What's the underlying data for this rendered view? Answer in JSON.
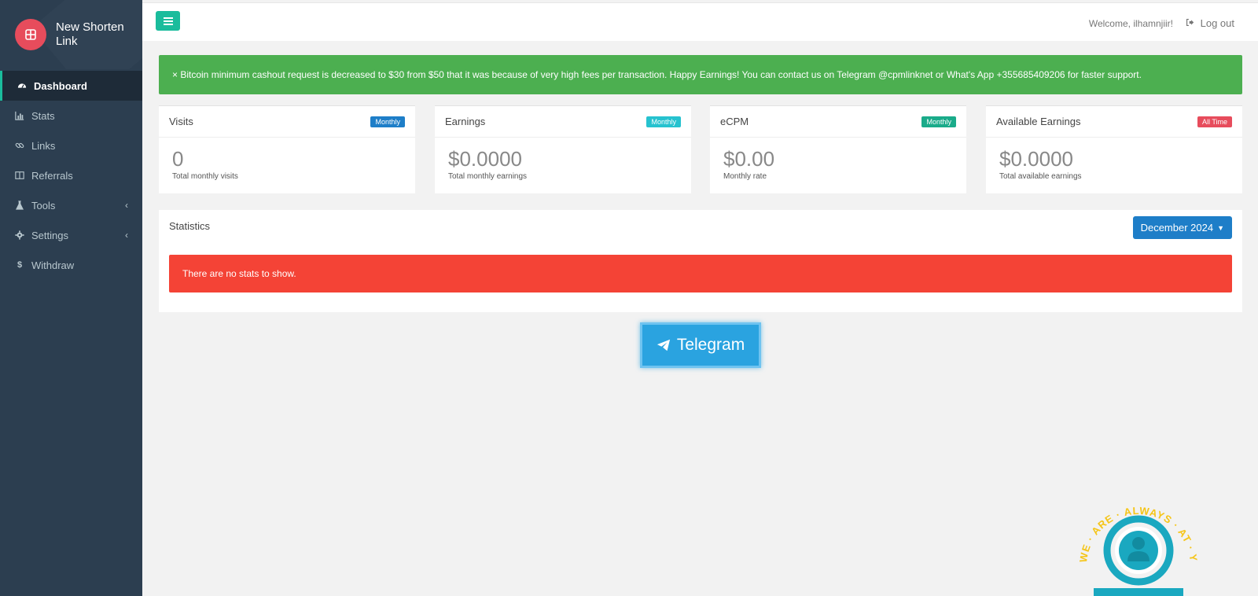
{
  "brand": {
    "name": "New Shorten Link"
  },
  "sidebar": {
    "items": [
      {
        "label": "Dashboard",
        "icon": "dashboard-icon",
        "active": true
      },
      {
        "label": "Stats",
        "icon": "bar-chart-icon"
      },
      {
        "label": "Links",
        "icon": "link-icon"
      },
      {
        "label": "Referrals",
        "icon": "columns-icon"
      },
      {
        "label": "Tools",
        "icon": "flask-icon",
        "chevron": "‹"
      },
      {
        "label": "Settings",
        "icon": "gear-icon",
        "chevron": "‹"
      },
      {
        "label": "Withdraw",
        "icon": "dollar-icon"
      }
    ]
  },
  "header": {
    "welcome": "Welcome, ilhamnjiir!",
    "logout": "Log out"
  },
  "announcement": {
    "text": "× Bitcoin minimum cashout request is decreased to $30 from $50 that it was because of very high fees per transaction. Happy Earnings! You can contact us on Telegram @cpmlinknet or What's App +355685409206 for faster support."
  },
  "cards": [
    {
      "title": "Visits",
      "badge": "Monthly",
      "badge_color": "#1e7ec8",
      "value": "0",
      "sub": "Total monthly visits"
    },
    {
      "title": "Earnings",
      "badge": "Monthly",
      "badge_color": "#26c2cf",
      "value": "$0.0000",
      "sub": "Total monthly earnings"
    },
    {
      "title": "eCPM",
      "badge": "Monthly",
      "badge_color": "#1aab8a",
      "value": "$0.00",
      "sub": "Monthly rate"
    },
    {
      "title": "Available Earnings",
      "badge": "All Time",
      "badge_color": "#e74c5c",
      "value": "$0.0000",
      "sub": "Total available earnings"
    }
  ],
  "statistics": {
    "title": "Statistics",
    "month": "December 2024",
    "empty_message": "There are no stats to show."
  },
  "telegram": {
    "label": "Telegram"
  },
  "support_badge": {
    "text": "WE · ARE · ALWAYS · AT · YOUR · SERVICE"
  },
  "colors": {
    "sidebar_bg": "#2c3e50",
    "accent": "#1abc9c",
    "success": "#4caf50",
    "danger": "#f44336",
    "primary": "#1e7ec8",
    "telegram": "#2aa3e0"
  }
}
